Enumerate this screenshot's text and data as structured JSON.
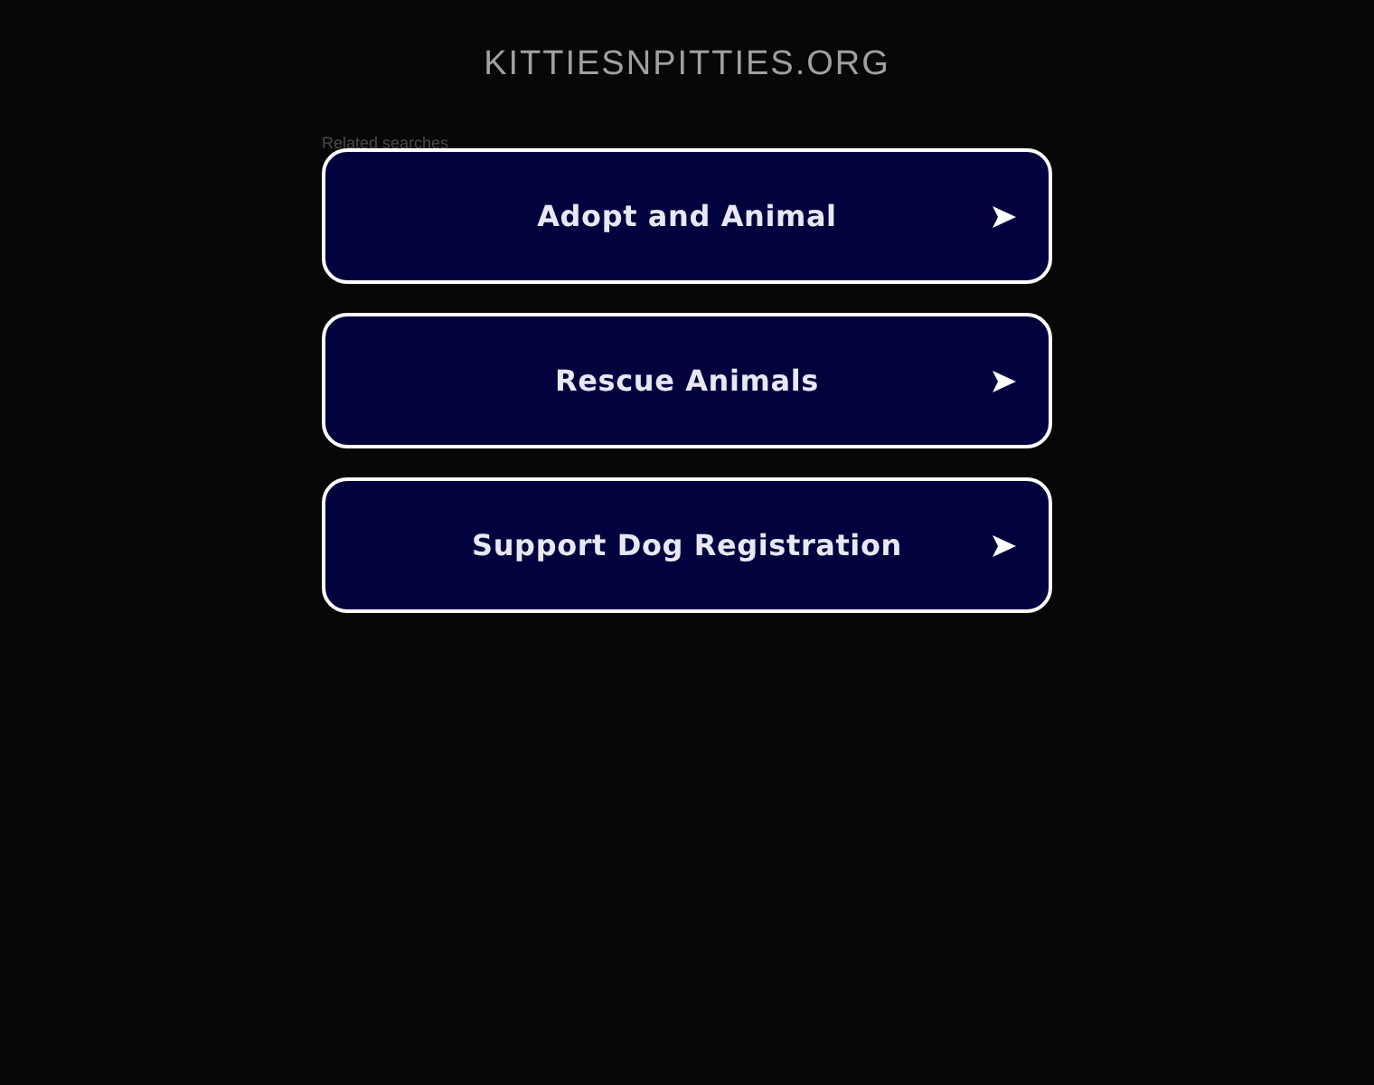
{
  "header": {
    "domain": "KITTIESNPITTIES.ORG"
  },
  "related": {
    "label": "Related searches",
    "links": [
      {
        "label": "Adopt and Animal"
      },
      {
        "label": "Rescue Animals"
      },
      {
        "label": "Support Dog Registration"
      }
    ]
  }
}
